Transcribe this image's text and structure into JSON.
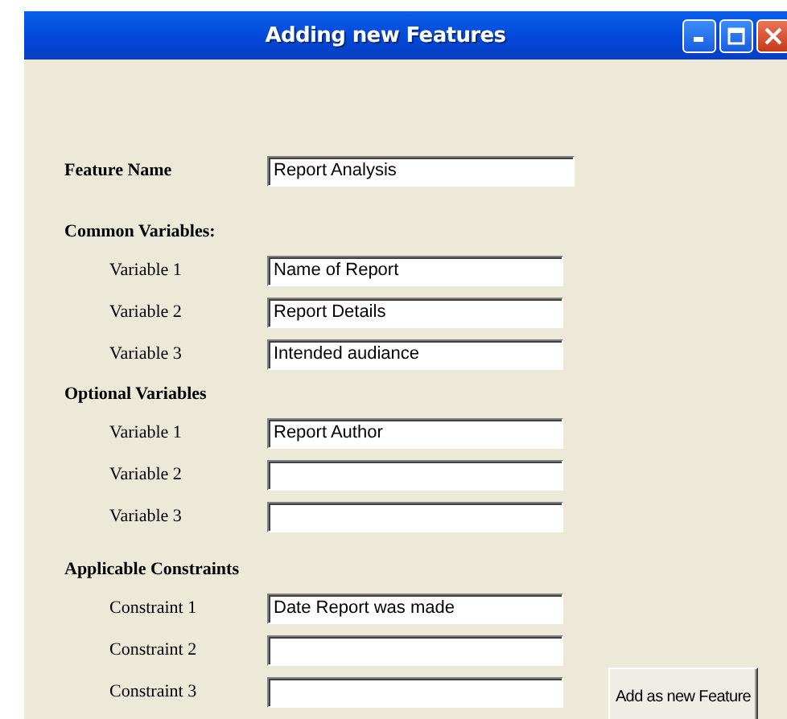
{
  "window": {
    "title": "Adding new Features"
  },
  "feature_name": {
    "label": "Feature Name",
    "value": "Report Analysis"
  },
  "sections": [
    {
      "heading": "Common Variables:",
      "fields": [
        {
          "label": "Variable 1",
          "value": "Name of Report"
        },
        {
          "label": "Variable 2",
          "value": "Report Details"
        },
        {
          "label": "Variable 3",
          "value": "Intended audiance"
        }
      ]
    },
    {
      "heading": "Optional Variables",
      "fields": [
        {
          "label": "Variable 1",
          "value": "Report Author"
        },
        {
          "label": "Variable 2"
        },
        {
          "label": "Variable 3"
        }
      ]
    },
    {
      "heading": "Applicable Constraints",
      "fields": [
        {
          "label": "Constraint 1",
          "value": "Date Report was made"
        },
        {
          "label": "Constraint 2"
        },
        {
          "label": "Constraint 3"
        }
      ]
    }
  ],
  "button": "Add as new Feature"
}
